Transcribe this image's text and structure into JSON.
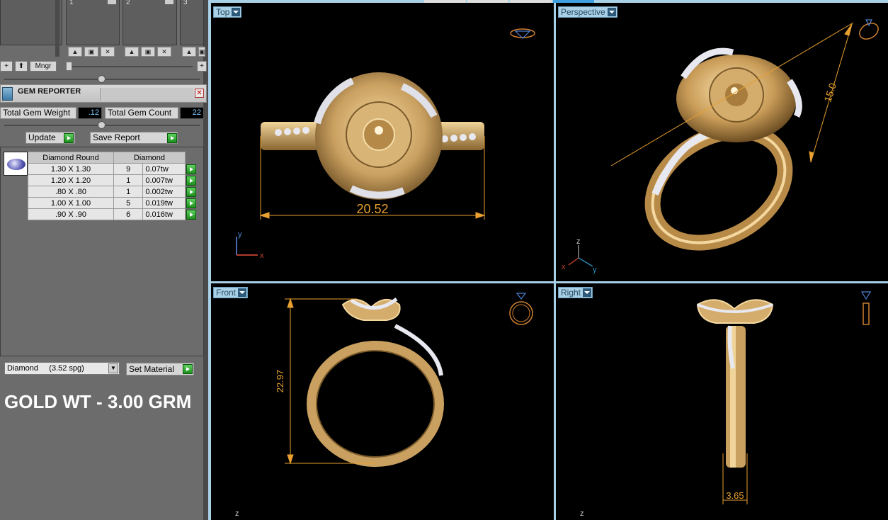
{
  "layers": {
    "slot_numbers": [
      "1",
      "2",
      "3"
    ],
    "manager_label": "Mngr",
    "add_symbol": "+",
    "up_symbol": "🠕"
  },
  "gem_reporter": {
    "title": "GEM REPORTER",
    "close_symbol": "✕",
    "total_gem_weight_label": "Total Gem Weight",
    "total_gem_weight_value": ".12",
    "total_gem_count_label": "Total Gem Count",
    "total_gem_count_value": "22",
    "update_label": "Update",
    "save_report_label": "Save Report",
    "table": {
      "headers": [
        "Diamond Round",
        "Diamond"
      ],
      "rows": [
        {
          "size": "1.30 X 1.30",
          "count": "9",
          "weight": "0.07tw"
        },
        {
          "size": "1.20 X 1.20",
          "count": "1",
          "weight": "0.007tw"
        },
        {
          "size": ".80 X .80",
          "count": "1",
          "weight": "0.002tw"
        },
        {
          "size": "1.00 X 1.00",
          "count": "5",
          "weight": "0.019tw"
        },
        {
          "size": ".90 X .90",
          "count": "6",
          "weight": "0.016tw"
        }
      ]
    },
    "material_value": "Diamond     (3.52 spg)",
    "set_material_label": "Set Material"
  },
  "overlay_text": "GOLD WT - 3.00 GRM",
  "viewports": {
    "top": {
      "label": "Top",
      "dimension": "20.52",
      "axis_x": "x",
      "axis_y": "y"
    },
    "perspective": {
      "label": "Perspective",
      "dimension": "15.0",
      "axis_x": "x",
      "axis_y": "y",
      "axis_z": "z"
    },
    "front": {
      "label": "Front",
      "dimension": "22.97",
      "axis_z": "z"
    },
    "right": {
      "label": "Right",
      "dimension": "3.65",
      "axis_z": "z"
    }
  },
  "colors": {
    "gold": "#c9a060",
    "dimension": "#e8a030",
    "viewport_bg": "#000000",
    "frame": "#a8d0e6"
  }
}
